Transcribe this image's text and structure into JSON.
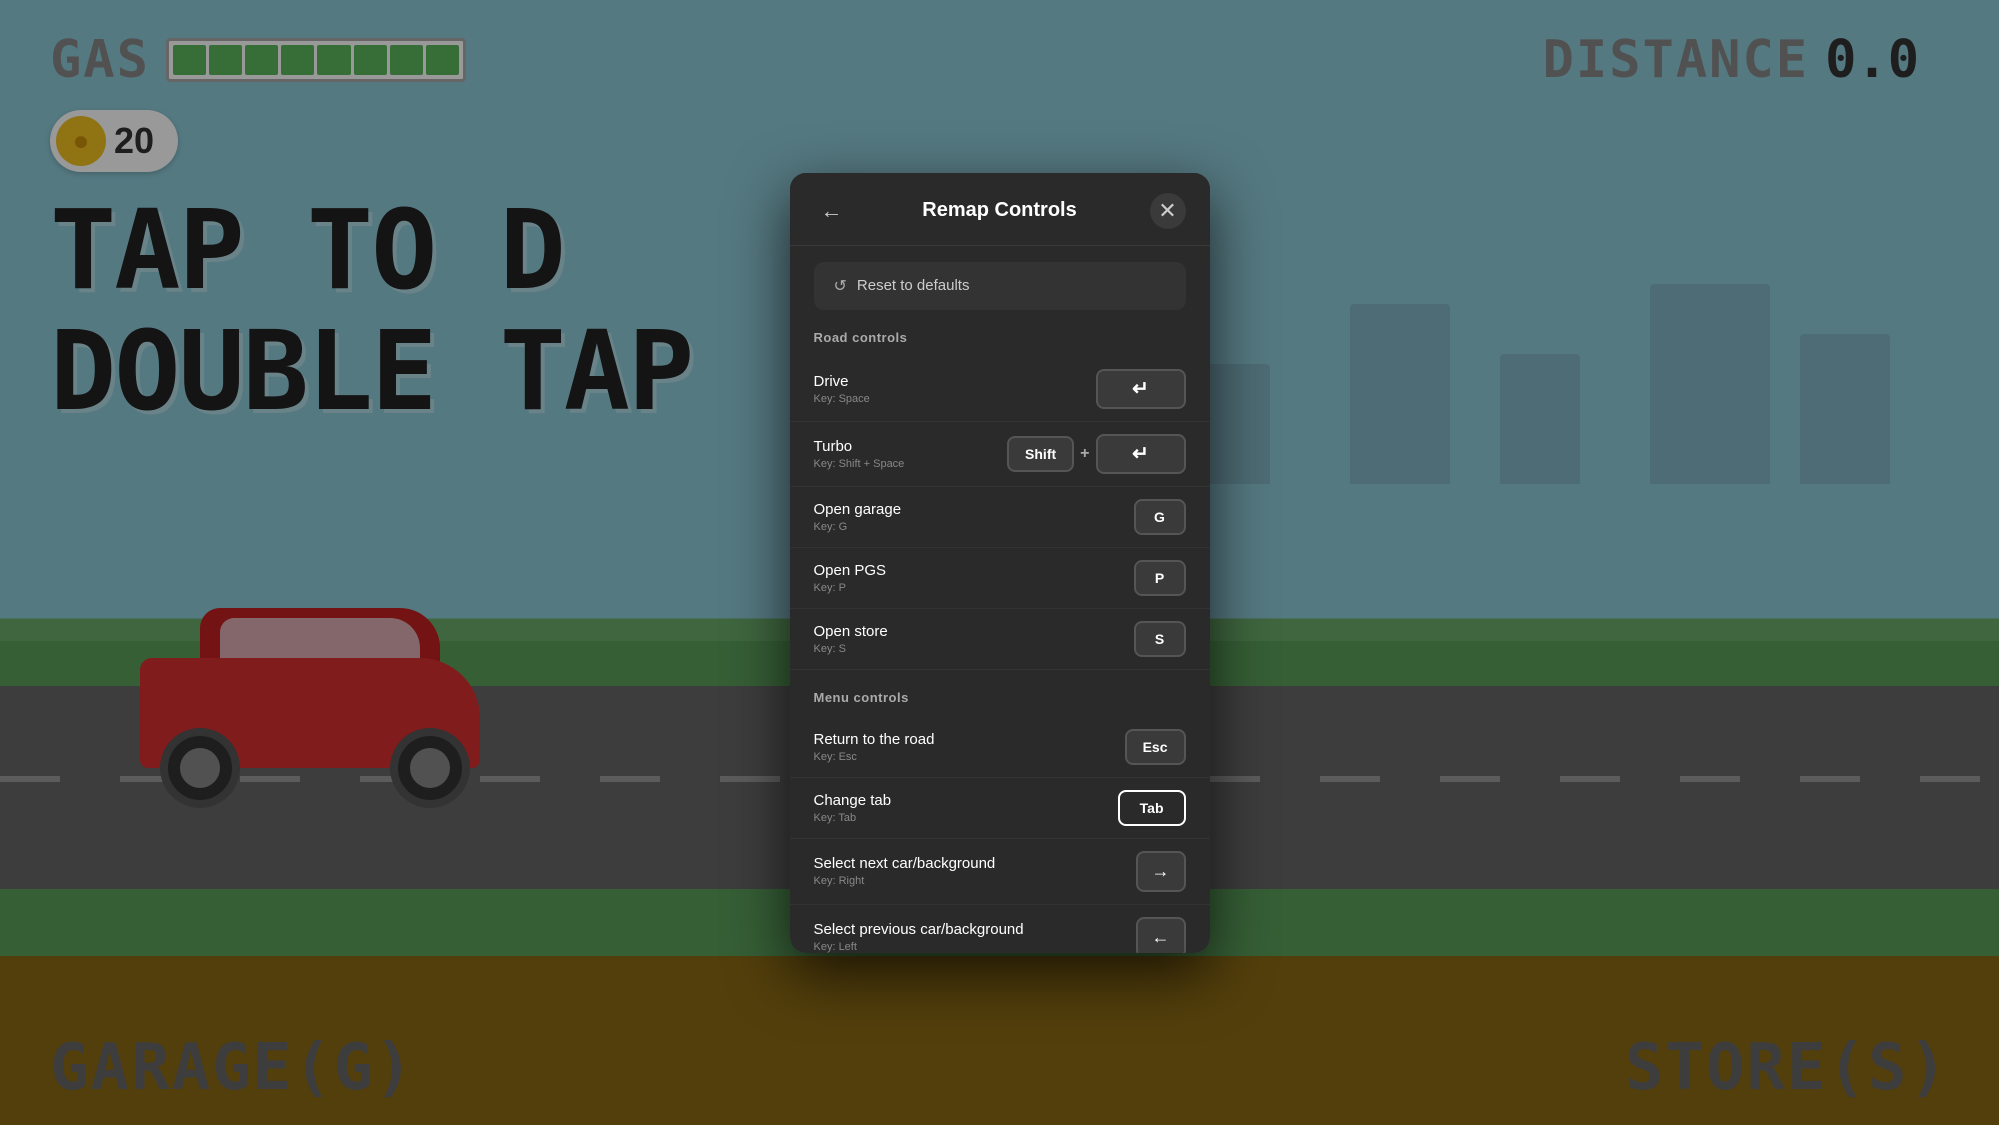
{
  "game": {
    "gas_label": "GAS",
    "distance_label": "DISTANCE",
    "distance_value": "0.0",
    "coin_count": "20",
    "tap_text_line1": "TAP TO D",
    "tap_text_line2": "DOUBLE TAP",
    "bottom_left": "GARAGE(G)",
    "bottom_right": "STORE(S)"
  },
  "modal": {
    "title": "Remap Controls",
    "back_label": "←",
    "close_label": "✕",
    "reset_label": "Reset to defaults",
    "reset_icon": "↺",
    "road_section": "Road controls",
    "menu_section": "Menu controls",
    "controls": {
      "drive": {
        "name": "Drive",
        "key_hint": "Key: Space",
        "key_display": "space"
      },
      "turbo": {
        "name": "Turbo",
        "key_hint": "Key: Shift + Space",
        "modifier": "Shift",
        "plus": "+",
        "key_display": "space"
      },
      "open_garage": {
        "name": "Open garage",
        "key_hint": "Key: G",
        "key_display": "G"
      },
      "open_pgs": {
        "name": "Open PGS",
        "key_hint": "Key: P",
        "key_display": "P"
      },
      "open_store": {
        "name": "Open store",
        "key_hint": "Key: S",
        "key_display": "S"
      },
      "return_road": {
        "name": "Return to the road",
        "key_hint": "Key: Esc",
        "key_display": "Esc"
      },
      "change_tab": {
        "name": "Change tab",
        "key_hint": "Key: Tab",
        "key_display": "Tab"
      },
      "next_car": {
        "name": "Select next car/background",
        "key_hint": "Key: Right",
        "key_display": "→"
      },
      "prev_car": {
        "name": "Select previous car/background",
        "key_hint": "Key: Left",
        "key_display": "←"
      }
    }
  }
}
